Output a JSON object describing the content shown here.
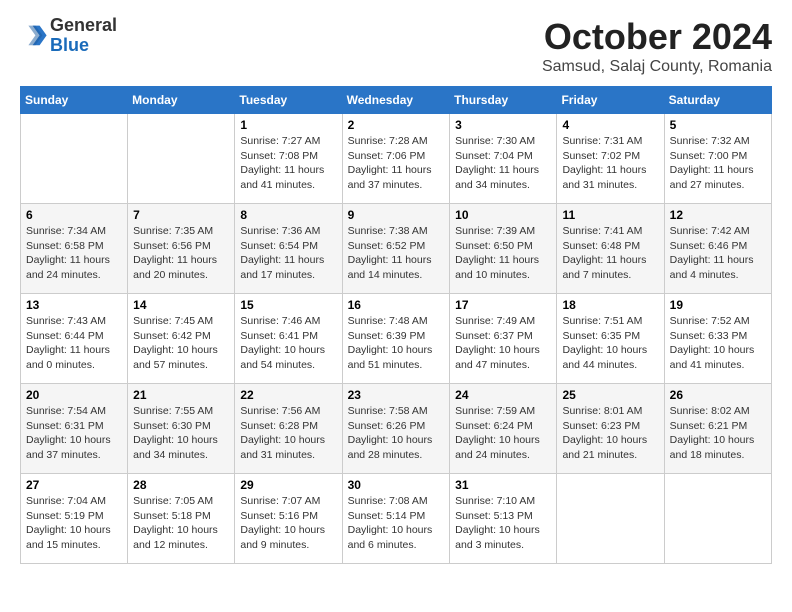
{
  "header": {
    "logo_general": "General",
    "logo_blue": "Blue",
    "month_title": "October 2024",
    "subtitle": "Samsud, Salaj County, Romania"
  },
  "days_of_week": [
    "Sunday",
    "Monday",
    "Tuesday",
    "Wednesday",
    "Thursday",
    "Friday",
    "Saturday"
  ],
  "weeks": [
    [
      {
        "day": "",
        "sunrise": "",
        "sunset": "",
        "daylight": ""
      },
      {
        "day": "",
        "sunrise": "",
        "sunset": "",
        "daylight": ""
      },
      {
        "day": "1",
        "sunrise": "Sunrise: 7:27 AM",
        "sunset": "Sunset: 7:08 PM",
        "daylight": "Daylight: 11 hours and 41 minutes."
      },
      {
        "day": "2",
        "sunrise": "Sunrise: 7:28 AM",
        "sunset": "Sunset: 7:06 PM",
        "daylight": "Daylight: 11 hours and 37 minutes."
      },
      {
        "day": "3",
        "sunrise": "Sunrise: 7:30 AM",
        "sunset": "Sunset: 7:04 PM",
        "daylight": "Daylight: 11 hours and 34 minutes."
      },
      {
        "day": "4",
        "sunrise": "Sunrise: 7:31 AM",
        "sunset": "Sunset: 7:02 PM",
        "daylight": "Daylight: 11 hours and 31 minutes."
      },
      {
        "day": "5",
        "sunrise": "Sunrise: 7:32 AM",
        "sunset": "Sunset: 7:00 PM",
        "daylight": "Daylight: 11 hours and 27 minutes."
      }
    ],
    [
      {
        "day": "6",
        "sunrise": "Sunrise: 7:34 AM",
        "sunset": "Sunset: 6:58 PM",
        "daylight": "Daylight: 11 hours and 24 minutes."
      },
      {
        "day": "7",
        "sunrise": "Sunrise: 7:35 AM",
        "sunset": "Sunset: 6:56 PM",
        "daylight": "Daylight: 11 hours and 20 minutes."
      },
      {
        "day": "8",
        "sunrise": "Sunrise: 7:36 AM",
        "sunset": "Sunset: 6:54 PM",
        "daylight": "Daylight: 11 hours and 17 minutes."
      },
      {
        "day": "9",
        "sunrise": "Sunrise: 7:38 AM",
        "sunset": "Sunset: 6:52 PM",
        "daylight": "Daylight: 11 hours and 14 minutes."
      },
      {
        "day": "10",
        "sunrise": "Sunrise: 7:39 AM",
        "sunset": "Sunset: 6:50 PM",
        "daylight": "Daylight: 11 hours and 10 minutes."
      },
      {
        "day": "11",
        "sunrise": "Sunrise: 7:41 AM",
        "sunset": "Sunset: 6:48 PM",
        "daylight": "Daylight: 11 hours and 7 minutes."
      },
      {
        "day": "12",
        "sunrise": "Sunrise: 7:42 AM",
        "sunset": "Sunset: 6:46 PM",
        "daylight": "Daylight: 11 hours and 4 minutes."
      }
    ],
    [
      {
        "day": "13",
        "sunrise": "Sunrise: 7:43 AM",
        "sunset": "Sunset: 6:44 PM",
        "daylight": "Daylight: 11 hours and 0 minutes."
      },
      {
        "day": "14",
        "sunrise": "Sunrise: 7:45 AM",
        "sunset": "Sunset: 6:42 PM",
        "daylight": "Daylight: 10 hours and 57 minutes."
      },
      {
        "day": "15",
        "sunrise": "Sunrise: 7:46 AM",
        "sunset": "Sunset: 6:41 PM",
        "daylight": "Daylight: 10 hours and 54 minutes."
      },
      {
        "day": "16",
        "sunrise": "Sunrise: 7:48 AM",
        "sunset": "Sunset: 6:39 PM",
        "daylight": "Daylight: 10 hours and 51 minutes."
      },
      {
        "day": "17",
        "sunrise": "Sunrise: 7:49 AM",
        "sunset": "Sunset: 6:37 PM",
        "daylight": "Daylight: 10 hours and 47 minutes."
      },
      {
        "day": "18",
        "sunrise": "Sunrise: 7:51 AM",
        "sunset": "Sunset: 6:35 PM",
        "daylight": "Daylight: 10 hours and 44 minutes."
      },
      {
        "day": "19",
        "sunrise": "Sunrise: 7:52 AM",
        "sunset": "Sunset: 6:33 PM",
        "daylight": "Daylight: 10 hours and 41 minutes."
      }
    ],
    [
      {
        "day": "20",
        "sunrise": "Sunrise: 7:54 AM",
        "sunset": "Sunset: 6:31 PM",
        "daylight": "Daylight: 10 hours and 37 minutes."
      },
      {
        "day": "21",
        "sunrise": "Sunrise: 7:55 AM",
        "sunset": "Sunset: 6:30 PM",
        "daylight": "Daylight: 10 hours and 34 minutes."
      },
      {
        "day": "22",
        "sunrise": "Sunrise: 7:56 AM",
        "sunset": "Sunset: 6:28 PM",
        "daylight": "Daylight: 10 hours and 31 minutes."
      },
      {
        "day": "23",
        "sunrise": "Sunrise: 7:58 AM",
        "sunset": "Sunset: 6:26 PM",
        "daylight": "Daylight: 10 hours and 28 minutes."
      },
      {
        "day": "24",
        "sunrise": "Sunrise: 7:59 AM",
        "sunset": "Sunset: 6:24 PM",
        "daylight": "Daylight: 10 hours and 24 minutes."
      },
      {
        "day": "25",
        "sunrise": "Sunrise: 8:01 AM",
        "sunset": "Sunset: 6:23 PM",
        "daylight": "Daylight: 10 hours and 21 minutes."
      },
      {
        "day": "26",
        "sunrise": "Sunrise: 8:02 AM",
        "sunset": "Sunset: 6:21 PM",
        "daylight": "Daylight: 10 hours and 18 minutes."
      }
    ],
    [
      {
        "day": "27",
        "sunrise": "Sunrise: 7:04 AM",
        "sunset": "Sunset: 5:19 PM",
        "daylight": "Daylight: 10 hours and 15 minutes."
      },
      {
        "day": "28",
        "sunrise": "Sunrise: 7:05 AM",
        "sunset": "Sunset: 5:18 PM",
        "daylight": "Daylight: 10 hours and 12 minutes."
      },
      {
        "day": "29",
        "sunrise": "Sunrise: 7:07 AM",
        "sunset": "Sunset: 5:16 PM",
        "daylight": "Daylight: 10 hours and 9 minutes."
      },
      {
        "day": "30",
        "sunrise": "Sunrise: 7:08 AM",
        "sunset": "Sunset: 5:14 PM",
        "daylight": "Daylight: 10 hours and 6 minutes."
      },
      {
        "day": "31",
        "sunrise": "Sunrise: 7:10 AM",
        "sunset": "Sunset: 5:13 PM",
        "daylight": "Daylight: 10 hours and 3 minutes."
      },
      {
        "day": "",
        "sunrise": "",
        "sunset": "",
        "daylight": ""
      },
      {
        "day": "",
        "sunrise": "",
        "sunset": "",
        "daylight": ""
      }
    ]
  ]
}
